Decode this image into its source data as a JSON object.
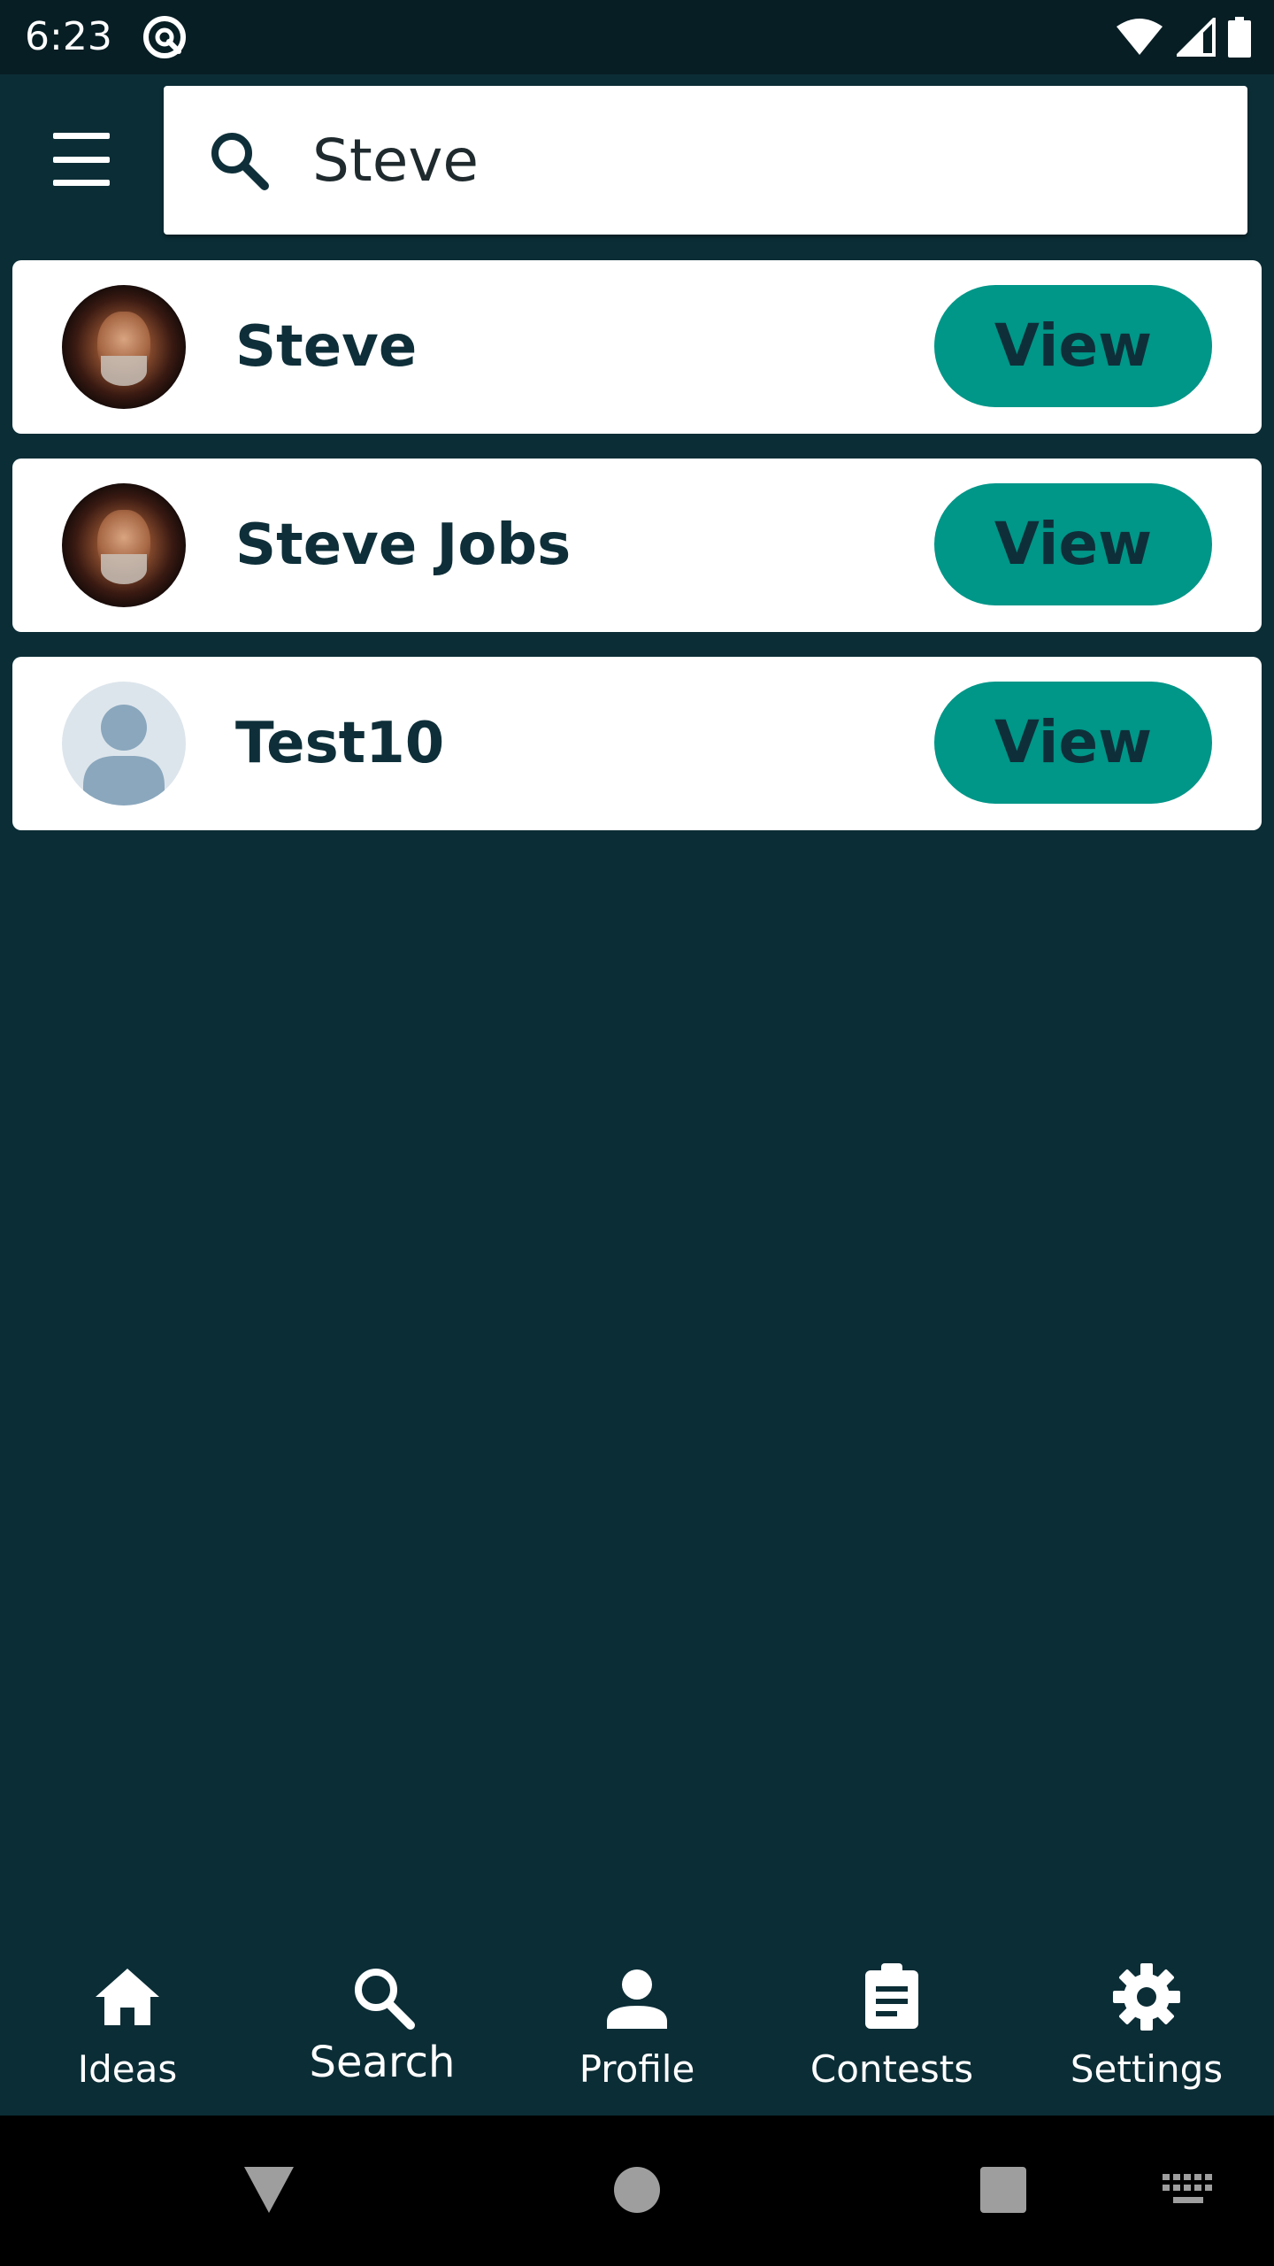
{
  "status_bar": {
    "time": "6:23",
    "icons": [
      "app-notification-icon",
      "wifi-icon",
      "cell-signal-icon",
      "battery-icon"
    ]
  },
  "header": {
    "menu_icon": "hamburger-menu-icon",
    "search": {
      "icon": "search-icon",
      "value": "Steve",
      "placeholder": ""
    }
  },
  "results": [
    {
      "name": "Steve",
      "avatar": "photo",
      "button_label": "View"
    },
    {
      "name": "Steve Jobs",
      "avatar": "photo",
      "button_label": "View"
    },
    {
      "name": "Test10",
      "avatar": "placeholder",
      "button_label": "View"
    }
  ],
  "bottom_nav": {
    "items": [
      {
        "label": "Ideas",
        "icon": "home-icon"
      },
      {
        "label": "Search",
        "icon": "search-icon",
        "active": true
      },
      {
        "label": "Profile",
        "icon": "person-icon"
      },
      {
        "label": "Contests",
        "icon": "clipboard-icon"
      },
      {
        "label": "Settings",
        "icon": "gear-icon"
      }
    ]
  },
  "system_nav": {
    "icons": [
      "back-icon",
      "home-icon",
      "recents-icon",
      "keyboard-icon"
    ]
  },
  "colors": {
    "background": "#0b2d36",
    "status_bar": "#071e24",
    "accent": "#009688",
    "card": "#ffffff",
    "text_dark": "#0e2f39"
  }
}
